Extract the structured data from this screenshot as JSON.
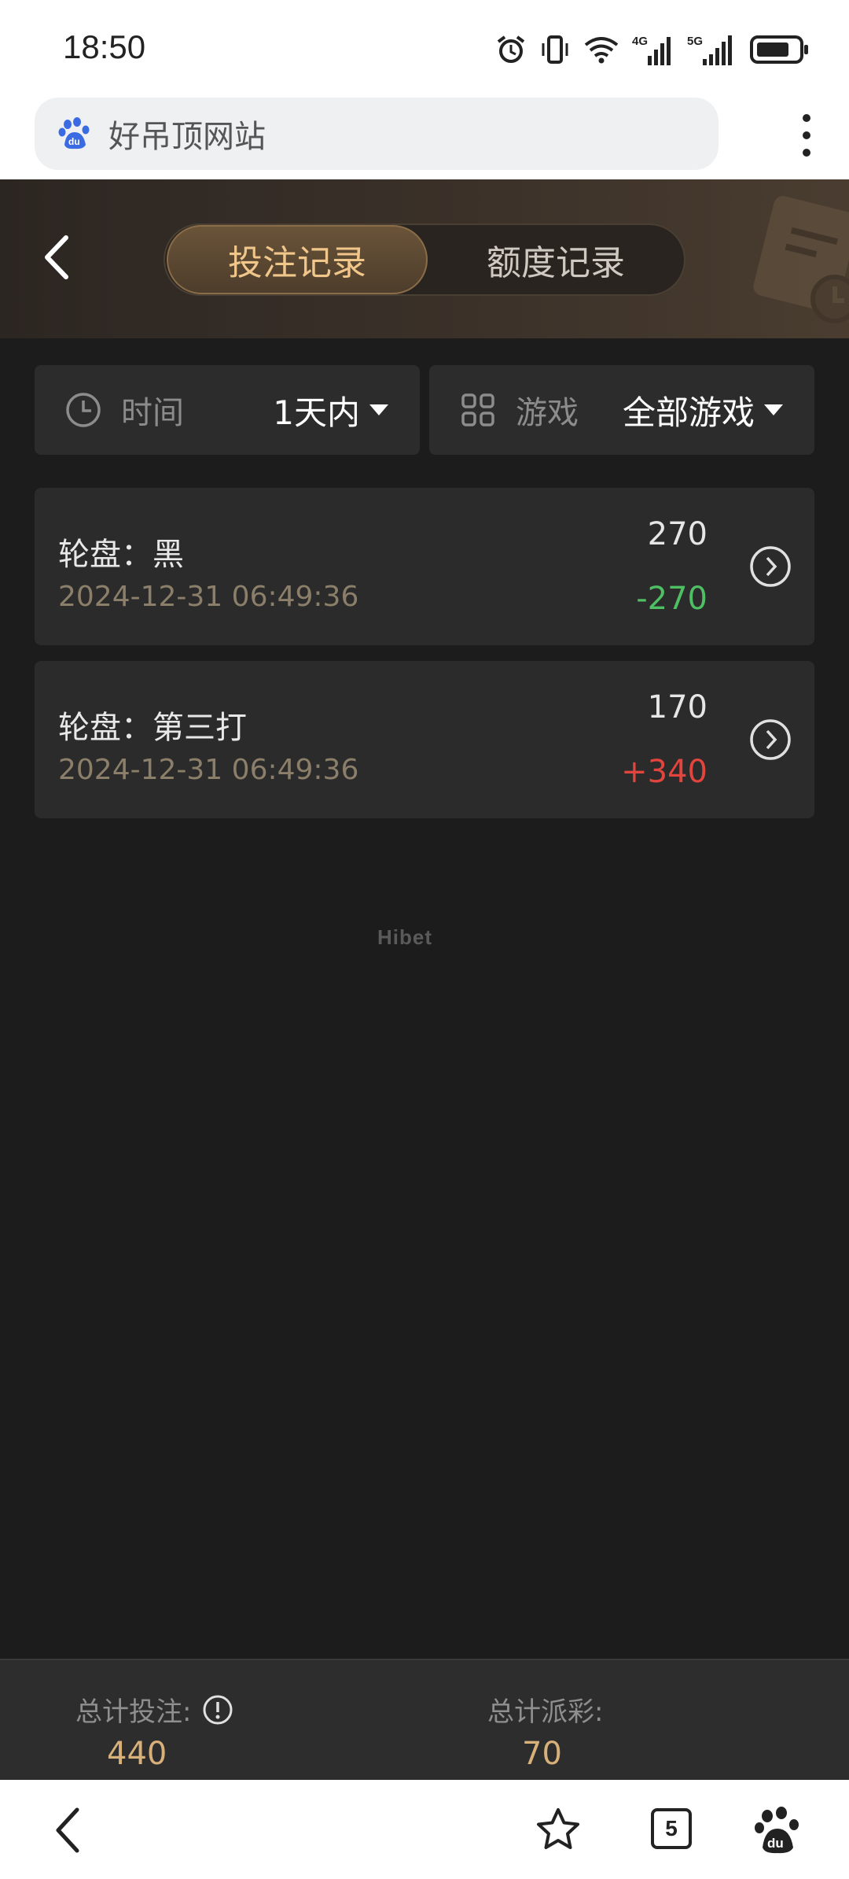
{
  "status": {
    "time": "18:50",
    "network_labels": [
      "4G",
      "5G"
    ]
  },
  "browser": {
    "address": "好吊顶网站"
  },
  "header": {
    "tabs": [
      {
        "label": "投注记录",
        "active": true
      },
      {
        "label": "额度记录",
        "active": false
      }
    ]
  },
  "filters": {
    "time": {
      "label": "时间",
      "value": "1天内"
    },
    "game": {
      "label": "游戏",
      "value": "全部游戏"
    }
  },
  "records": [
    {
      "name": "轮盘：黑",
      "time": "2024-12-31 06:49:36",
      "amount": "270",
      "result": "-270",
      "result_color": "#4fbf63"
    },
    {
      "name": "轮盘：第三打",
      "time": "2024-12-31 06:49:36",
      "amount": "170",
      "result": "+340",
      "result_color": "#e2453d"
    }
  ],
  "watermark": "Hibet",
  "totals": {
    "bet_label": "总计投注:",
    "bet_value": "440",
    "payout_label": "总计派彩:",
    "payout_value": "70"
  },
  "bottom_nav": {
    "tab_count": "5"
  },
  "colors": {
    "accent_gold": "#f1c68a",
    "loss_green": "#4fbf63",
    "win_red": "#e2453d",
    "total_gold": "#d8b07a"
  }
}
